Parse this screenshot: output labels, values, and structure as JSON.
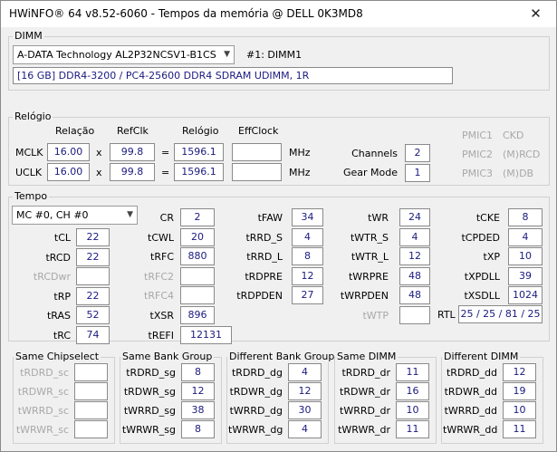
{
  "window": {
    "title": "HWiNFO® 64 v8.52-6060 - Tempos da memória @ DELL 0K3MD8",
    "close_glyph": "✕"
  },
  "dimm": {
    "group": "DIMM",
    "module": "A-DATA Technology AL2P32NCSV1-B1CS",
    "slot": "#1: DIMM1",
    "desc": "[16 GB] DDR4-3200 / PC4-25600 DDR4 SDRAM UDIMM, 1R"
  },
  "clock": {
    "group": "Relógio",
    "h_rel": "Relação",
    "h_ref": "RefClk",
    "h_clk": "Relógio",
    "h_eff": "EffClock",
    "mclk": {
      "label": "MCLK",
      "ratio": "16.00",
      "x": "x",
      "ref": "99.8",
      "eq": "=",
      "clock": "1596.1",
      "eff": "",
      "unit": "MHz"
    },
    "uclk": {
      "label": "UCLK",
      "ratio": "16.00",
      "x": "x",
      "ref": "99.8",
      "eq": "=",
      "clock": "1596.1",
      "eff": "",
      "unit": "MHz"
    },
    "channels_label": "Channels",
    "channels": "2",
    "geardown_label": "Gear Mode",
    "geardown": "1",
    "pmic": [
      "PMIC1",
      "PMIC2",
      "PMIC3"
    ],
    "pmic_vals": [
      "CKD",
      "(M)RCD",
      "(M)DB"
    ]
  },
  "timing": {
    "group": "Tempo",
    "channel": "MC #0, CH #0",
    "c1": [
      {
        "l": "tCL",
        "v": "22"
      },
      {
        "l": "tRCD",
        "v": "22"
      },
      {
        "l": "tRCDwr",
        "v": ""
      },
      {
        "l": "tRP",
        "v": "22"
      },
      {
        "l": "tRAS",
        "v": "52"
      },
      {
        "l": "tRC",
        "v": "74"
      }
    ],
    "c2": [
      {
        "l": "CR",
        "v": "2"
      },
      {
        "l": "tCWL",
        "v": "20"
      },
      {
        "l": "tRFC",
        "v": "880"
      },
      {
        "l": "tRFC2",
        "v": ""
      },
      {
        "l": "tRFC4",
        "v": ""
      },
      {
        "l": "tXSR",
        "v": "896"
      },
      {
        "l": "tREFI",
        "v": "12131"
      }
    ],
    "c3": [
      {
        "l": "tFAW",
        "v": "34"
      },
      {
        "l": "tRRD_S",
        "v": "4"
      },
      {
        "l": "tRRD_L",
        "v": "8"
      },
      {
        "l": "tRDPRE",
        "v": "12"
      },
      {
        "l": "tRDPDEN",
        "v": "27"
      }
    ],
    "c4": [
      {
        "l": "tWR",
        "v": "24"
      },
      {
        "l": "tWTR_S",
        "v": "4"
      },
      {
        "l": "tWTR_L",
        "v": "12"
      },
      {
        "l": "tWRPRE",
        "v": "48"
      },
      {
        "l": "tWRPDEN",
        "v": "48"
      },
      {
        "l": "tWTP",
        "v": ""
      }
    ],
    "c5": [
      {
        "l": "tCKE",
        "v": "8"
      },
      {
        "l": "tCPDED",
        "v": "4"
      },
      {
        "l": "tXP",
        "v": "10"
      },
      {
        "l": "tXPDLL",
        "v": "39"
      },
      {
        "l": "tXSDLL",
        "v": "1024"
      }
    ],
    "rtl_label": "RTL",
    "rtl": "25 / 25 / 81 / 25"
  },
  "groups": [
    {
      "title": "Same Chipselect",
      "rows": [
        {
          "l": "tRDRD_sc",
          "v": ""
        },
        {
          "l": "tRDWR_sc",
          "v": ""
        },
        {
          "l": "tWRRD_sc",
          "v": ""
        },
        {
          "l": "tWRWR_sc",
          "v": ""
        }
      ]
    },
    {
      "title": "Same Bank Group",
      "rows": [
        {
          "l": "tRDRD_sg",
          "v": "8"
        },
        {
          "l": "tRDWR_sg",
          "v": "12"
        },
        {
          "l": "tWRRD_sg",
          "v": "38"
        },
        {
          "l": "tWRWR_sg",
          "v": "8"
        }
      ]
    },
    {
      "title": "Different Bank Group",
      "rows": [
        {
          "l": "tRDRD_dg",
          "v": "4"
        },
        {
          "l": "tRDWR_dg",
          "v": "12"
        },
        {
          "l": "tWRRD_dg",
          "v": "30"
        },
        {
          "l": "tWRWR_dg",
          "v": "4"
        }
      ]
    },
    {
      "title": "Same DIMM",
      "rows": [
        {
          "l": "tRDRD_dr",
          "v": "11"
        },
        {
          "l": "tRDWR_dr",
          "v": "16"
        },
        {
          "l": "tWRRD_dr",
          "v": "10"
        },
        {
          "l": "tWRWR_dr",
          "v": "11"
        }
      ]
    },
    {
      "title": "Different DIMM",
      "rows": [
        {
          "l": "tRDRD_dd",
          "v": "12"
        },
        {
          "l": "tRDWR_dd",
          "v": "19"
        },
        {
          "l": "tWRRD_dd",
          "v": "10"
        },
        {
          "l": "tWRWR_dd",
          "v": "11"
        }
      ]
    }
  ]
}
